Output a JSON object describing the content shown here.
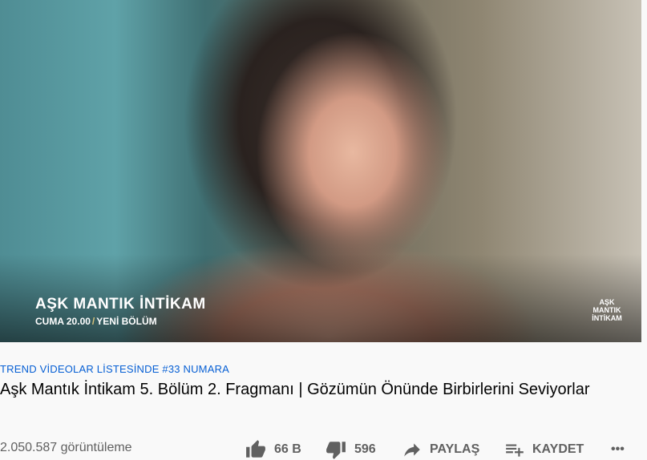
{
  "video": {
    "overlay_title": "AŞK MANTIK İNTİKAM",
    "overlay_day": "CUMA 20.00",
    "overlay_sep": "/",
    "overlay_new": "YENİ BÖLÜM",
    "logo_line1": "AŞK",
    "logo_line2": "MANTIK",
    "logo_line3": "İNTİKAM"
  },
  "info": {
    "trending": "TREND VİDEOLAR LİSTESİNDE #33 NUMARA",
    "title": "Aşk Mantık İntikam 5. Bölüm 2. Fragmanı | Gözümün Önünde Birbirlerini Seviyorlar",
    "views": "2.050.587 görüntüleme"
  },
  "actions": {
    "like_count": "66 B",
    "dislike_count": "596",
    "share_label": "PAYLAŞ",
    "save_label": "KAYDET",
    "more_label": "•••"
  },
  "colors": {
    "link": "#065fd4",
    "text": "#030303",
    "secondary": "#606060"
  },
  "icons": [
    "thumbs-up-icon",
    "thumbs-down-icon",
    "share-arrow-icon",
    "playlist-add-icon",
    "more-icon"
  ]
}
